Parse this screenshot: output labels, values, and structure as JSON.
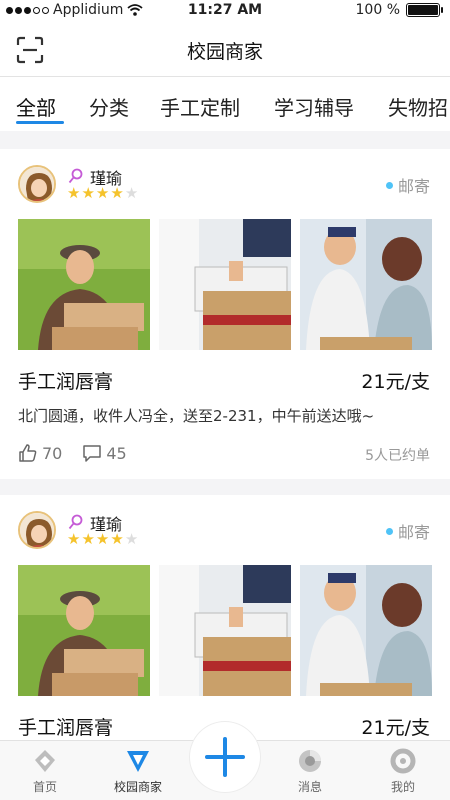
{
  "status": {
    "carrier": "Applidium",
    "time": "11:27 AM",
    "battery": "100 %",
    "battery_level": 1.0
  },
  "header": {
    "title": "校园商家"
  },
  "tabs": [
    "全部",
    "分类",
    "手工定制",
    "学习辅导",
    "失物招"
  ],
  "posts": [
    {
      "seller": "瑾瑜",
      "rating": 4,
      "rating_max": 5,
      "shipping": "邮寄",
      "title": "手工润唇膏",
      "price": "21元/支",
      "description": "北门圆通，收件人冯全，送至2-231，中午前送达哦~",
      "likes": "70",
      "comments": "45",
      "booked": "5人已约单"
    },
    {
      "seller": "瑾瑜",
      "rating": 4,
      "rating_max": 5,
      "shipping": "邮寄",
      "title": "手工润唇膏",
      "price": "21元/支"
    }
  ],
  "tabbar": {
    "home": "首页",
    "merchants": "校园商家",
    "messages": "消息",
    "mine": "我的"
  },
  "colors": {
    "accent": "#1e88e5",
    "star": "#f5c32c",
    "ship_dot": "#4fc3f7",
    "female": "#c55bd6"
  }
}
